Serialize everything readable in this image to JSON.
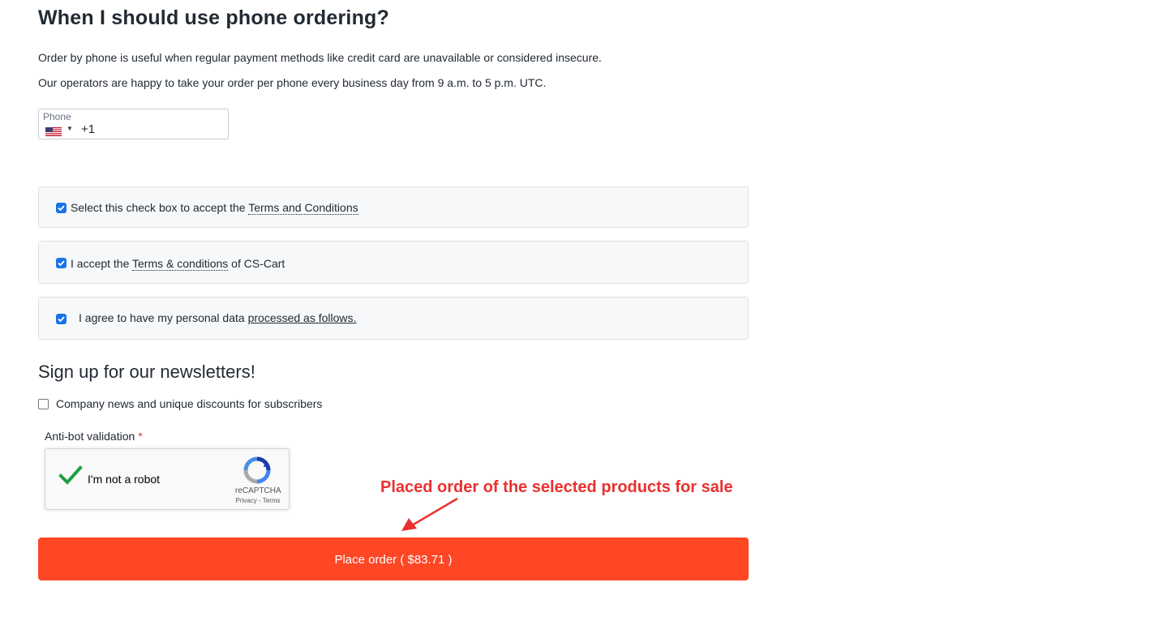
{
  "section": {
    "title": "When I should use phone ordering?",
    "paragraph1": "Order by phone is useful when regular payment methods like credit card are unavailable or considered insecure.",
    "paragraph2": "Our operators are happy to take your order per phone every business day from 9 a.m. to 5 p.m. UTC."
  },
  "phone": {
    "label": "Phone",
    "value": "+1",
    "country_icon": "us-flag-icon"
  },
  "agreements": [
    {
      "checked": true,
      "prefix": "Select this check box to accept the ",
      "link": "Terms and Conditions",
      "suffix": ""
    },
    {
      "checked": true,
      "prefix": "I accept the ",
      "link": "Terms & conditions",
      "suffix": " of CS-Cart"
    },
    {
      "checked": true,
      "prefix": "I agree to have my personal data ",
      "link": "processed as follows.",
      "suffix": ""
    }
  ],
  "newsletter": {
    "title": "Sign up for our newsletters!",
    "option_label": "Company news and unique discounts for subscribers",
    "checked": false
  },
  "antibot": {
    "label": "Anti-bot validation",
    "required_mark": "*",
    "recaptcha_text": "I'm not a robot",
    "recaptcha_brand": "reCAPTCHA",
    "recaptcha_links": "Privacy - Terms",
    "verified": true
  },
  "annotation": {
    "text": "Placed order of the selected products for sale",
    "color": "#e8312f"
  },
  "place_order": {
    "label": "Place order ( $83.71 )",
    "color": "#ff4625"
  }
}
